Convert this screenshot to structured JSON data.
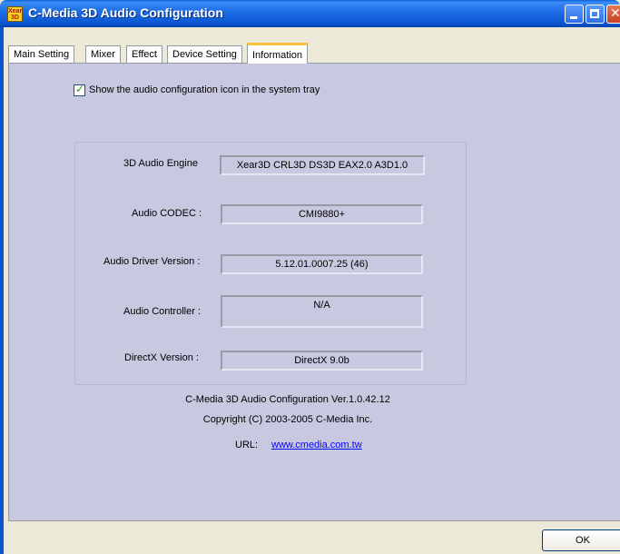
{
  "window": {
    "title": "C-Media 3D Audio Configuration",
    "icon_text": "Xear 3D"
  },
  "tabs": [
    {
      "label": "Main Setting",
      "active": false
    },
    {
      "label": "Mixer",
      "active": false
    },
    {
      "label": "Effect",
      "active": false
    },
    {
      "label": "Device Setting",
      "active": false
    },
    {
      "label": "Information",
      "active": true
    }
  ],
  "information": {
    "tray_checkbox": {
      "label": "Show the audio configuration icon in the system tray",
      "checked": true
    },
    "rows": [
      {
        "label": "3D Audio Engine",
        "value": "Xear3D  CRL3D  DS3D  EAX2.0  A3D1.0"
      },
      {
        "label": "Audio CODEC :",
        "value": "CMI9880+"
      },
      {
        "label": "Audio Driver Version :",
        "value": "5.12.01.0007.25 (46)"
      },
      {
        "label": "Audio Controller :",
        "value": "N/A"
      },
      {
        "label": "DirectX Version :",
        "value": "DirectX 9.0b"
      }
    ],
    "version_line": "C-Media 3D Audio Configuration Ver.1.0.42.12",
    "copyright_line": "Copyright (C) 2003-2005 C-Media Inc.",
    "url_label": "URL:",
    "url": "www.cmedia.com.tw"
  },
  "buttons": {
    "ok": "OK"
  },
  "colors": {
    "titlebar": "#0b55d0",
    "panel": "#c8c8e0",
    "link": "#0000ff",
    "active_tab_accent": "#f9c13a"
  },
  "icons": [
    "app-icon",
    "minimize-icon",
    "maximize-icon",
    "close-icon",
    "check-icon"
  ]
}
